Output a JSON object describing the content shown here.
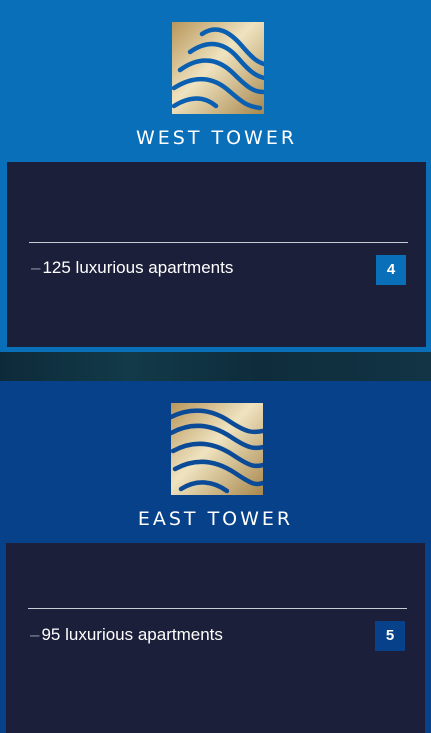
{
  "towers": [
    {
      "name": "WEST TOWER",
      "logo_icon": "gold-wave-logo-icon",
      "feature_dash": "–",
      "feature_text": "125 luxurious apartments",
      "page_number": "4",
      "accent_color": "#0a6fb9"
    },
    {
      "name": "EAST TOWER",
      "logo_icon": "gold-wave-logo-icon",
      "feature_dash": "–",
      "feature_text": "95 luxurious apartments",
      "page_number": "5",
      "accent_color": "#07418a"
    }
  ],
  "colors": {
    "panel": "#1b1f39",
    "logo_gold_light": "#e8d9b0",
    "logo_gold_dark": "#a8874c",
    "logo_wave": "#0b5fb0"
  }
}
